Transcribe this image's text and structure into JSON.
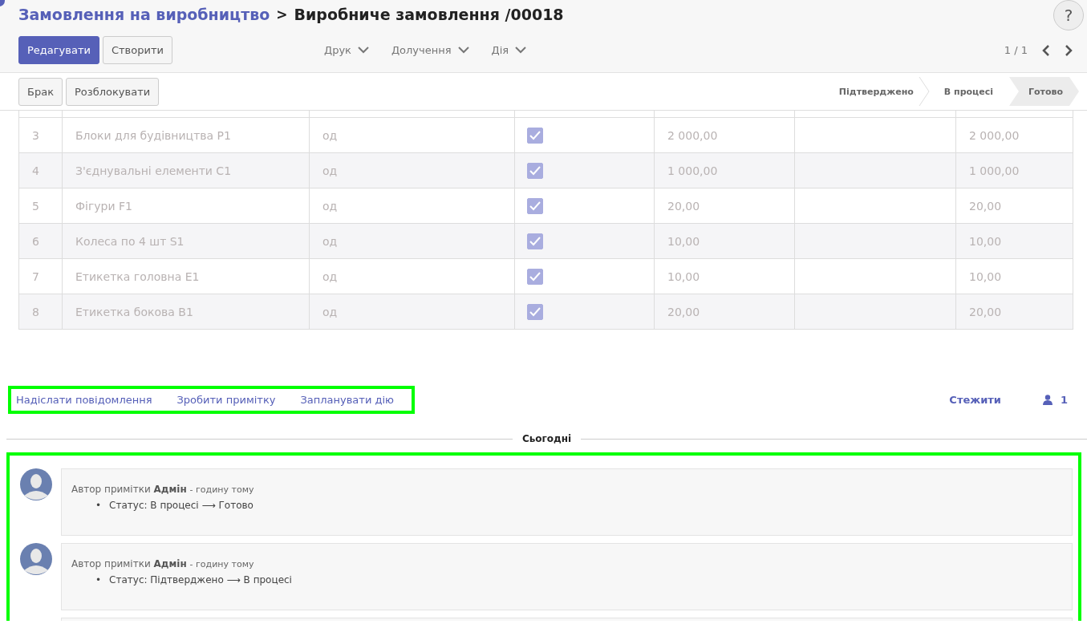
{
  "breadcrumb": {
    "parent": "Замовлення на виробництво",
    "separator": ">",
    "current": "Виробниче замовлення /00018"
  },
  "help_button": "?",
  "toolbar": {
    "buttons": [
      {
        "label": "Редагувати",
        "primary": true
      },
      {
        "label": "Створити",
        "primary": false
      }
    ],
    "menus": [
      "Друк",
      "Долучення",
      "Дія"
    ],
    "pager": "1 / 1"
  },
  "action_buttons": [
    "Брак",
    "Розблокувати"
  ],
  "status_steps": [
    {
      "label": "Підтверджено",
      "selected": false
    },
    {
      "label": "В процесі",
      "selected": false
    },
    {
      "label": "Готово",
      "selected": true
    }
  ],
  "table": {
    "rows": [
      {
        "number": "3",
        "product": "Блоки для будівництва P1",
        "unit": "од",
        "checked": true,
        "quantity": "2 000,00",
        "total": "2 000,00"
      },
      {
        "number": "4",
        "product": "З'єднувальні елементи С1",
        "unit": "од",
        "checked": true,
        "quantity": "1 000,00",
        "total": "1 000,00"
      },
      {
        "number": "5",
        "product": "Фігури F1",
        "unit": "од",
        "checked": true,
        "quantity": "20,00",
        "total": "20,00"
      },
      {
        "number": "6",
        "product": "Колеса по 4 шт S1",
        "unit": "од",
        "checked": true,
        "quantity": "10,00",
        "total": "10,00"
      },
      {
        "number": "7",
        "product": "Етикетка головна Е1",
        "unit": "од",
        "checked": true,
        "quantity": "10,00",
        "total": "10,00"
      },
      {
        "number": "8",
        "product": "Етикетка бокова В1",
        "unit": "од",
        "checked": true,
        "quantity": "20,00",
        "total": "20,00"
      }
    ]
  },
  "chatter": {
    "links": [
      "Надіслати повідомлення",
      "Зробити примітку",
      "Запланувати дію"
    ],
    "follow": "Стежити",
    "followers": "1",
    "date_separator": "Сьогодні",
    "messages": [
      {
        "prefix": "Автор примітки",
        "author": "Адмін",
        "time": "- годину тому",
        "bullet": "•",
        "from": "Статус: В процесі",
        "arrow": "⟶",
        "to": "Готово"
      },
      {
        "prefix": "Автор примітки",
        "author": "Адмін",
        "time": "- годину тому",
        "bullet": "•",
        "from": "Статус: Підтверджено",
        "arrow": "⟶",
        "to": "В процесі"
      }
    ]
  }
}
